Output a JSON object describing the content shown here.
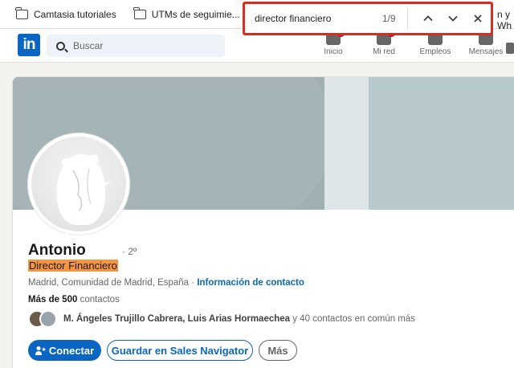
{
  "bookmarks": {
    "items": [
      {
        "label": "Camtasia tutoriales"
      },
      {
        "label": "UTMs de seguimie..."
      },
      {
        "label": ""
      }
    ],
    "partial_right": "n y Wh"
  },
  "find_bar": {
    "query": "director financiero",
    "count": "1/9"
  },
  "nav": {
    "search_placeholder": "Buscar",
    "items": [
      {
        "label": "Inicio"
      },
      {
        "label": "Mi red"
      },
      {
        "label": "Empleos"
      },
      {
        "label": "Mensajes"
      }
    ]
  },
  "profile": {
    "name": "Antonio",
    "degree": "· 2º",
    "headline": "Director Financiero",
    "location": "Madrid, Comunidad de Madrid, España",
    "location_sep": " · ",
    "contact_info": "Información de contacto",
    "connections_count": "Más de 500",
    "connections_suffix": " contactos",
    "mutual_names": "M. Ángeles Trujillo Cabrera, Luis Arias Hormaechea",
    "mutual_suffix": " y 40 contactos en común más"
  },
  "actions": {
    "connect": "Conectar",
    "sales_navigator": "Guardar en Sales Navigator",
    "more": "Más"
  },
  "colors": {
    "linkedin_blue": "#0a66c2",
    "highlight_orange": "#f59542",
    "find_bar_border": "#d92d20"
  }
}
